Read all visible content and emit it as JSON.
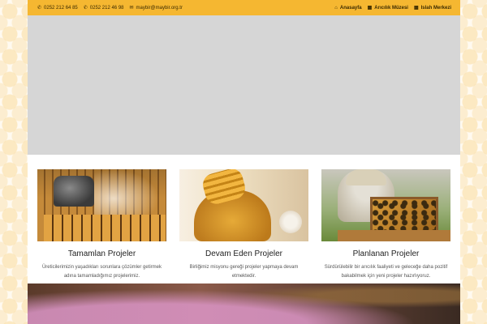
{
  "topbar": {
    "phone1": "0252 212 64 85",
    "phone2": "0252 212 46 98",
    "email": "maybir@maybir.org.tr",
    "nav": [
      {
        "label": "Anasayfa",
        "icon": "home-icon"
      },
      {
        "label": "Arıcılık Müzesi",
        "icon": "building-icon"
      },
      {
        "label": "Islah Merkezi",
        "icon": "building-icon"
      }
    ]
  },
  "cards": [
    {
      "title": "Tamamlan Projeler",
      "text": "Üreticilerimizin yaşadıkları sorunlara çözümler getirmek adına tamamladığımız projelerimiz."
    },
    {
      "title": "Devam Eden Projeler",
      "text": "Birliğimiz misyonu gereği projeler yapmaya devam etmektedir."
    },
    {
      "title": "Planlanan Projeler",
      "text": "Sürdürülebilir bir arıcılık faaliyeti ve geleceğe daha pozitif bakabilmek için yeni projeler hazırlıyoruz."
    }
  ],
  "colors": {
    "topbar": "#f5b731",
    "slider_placeholder": "#d6d6d6"
  }
}
